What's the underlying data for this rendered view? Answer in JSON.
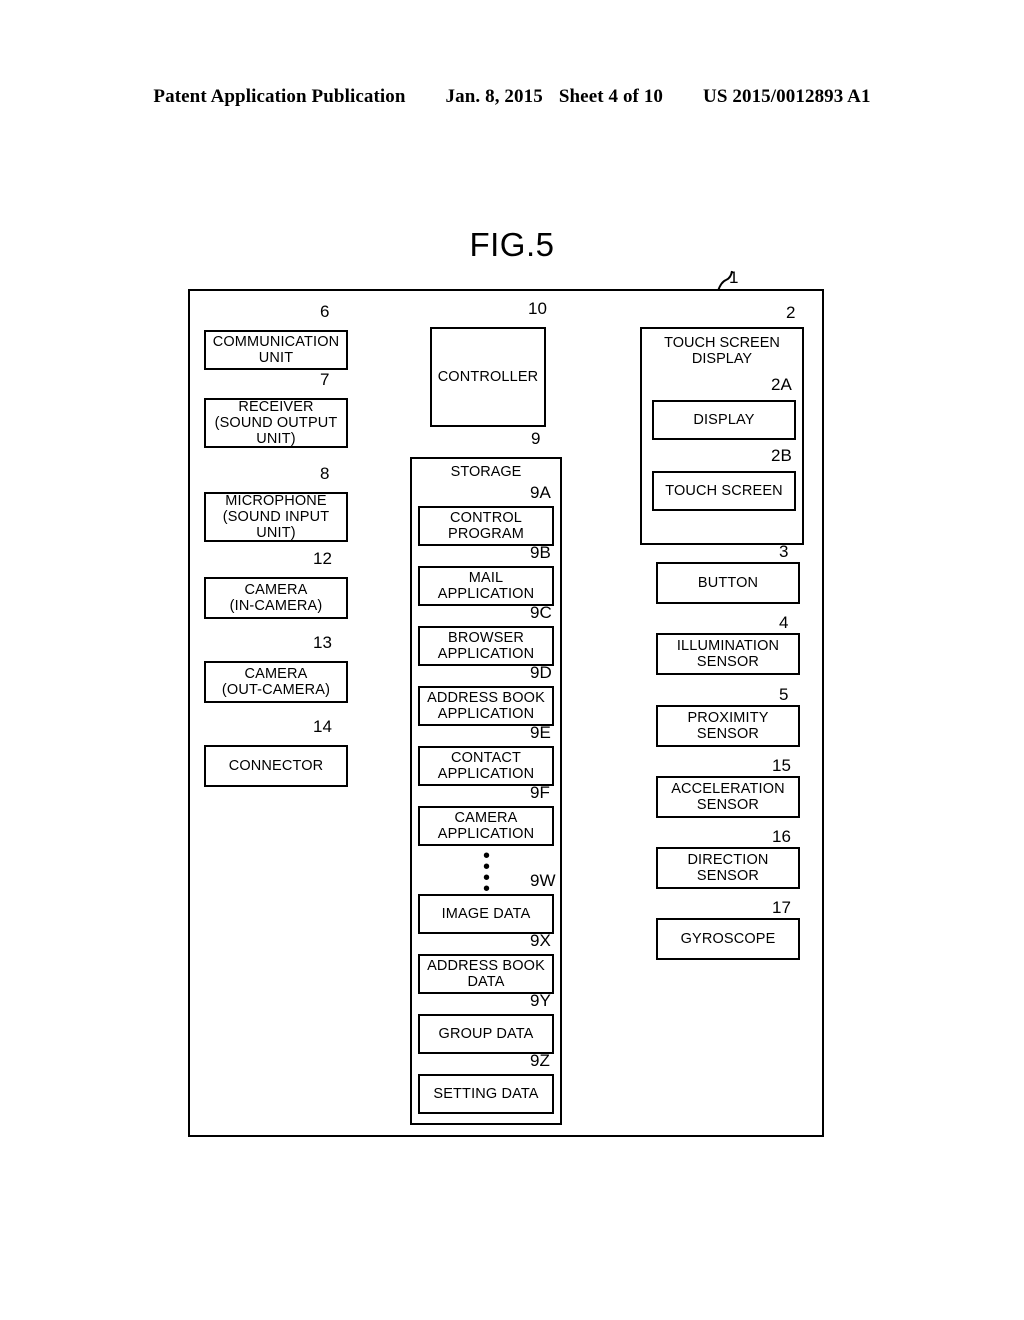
{
  "header": {
    "left": "Patent Application Publication",
    "date": "Jan. 8, 2015",
    "sheet": "Sheet 4 of 10",
    "pubnum": "US 2015/0012893 A1"
  },
  "figure": {
    "title": "FIG.5",
    "device_ref": "1"
  },
  "blocks": {
    "communication_unit": {
      "label": "COMMUNICATION\nUNIT",
      "ref": "6"
    },
    "receiver": {
      "label": "RECEIVER\n(SOUND OUTPUT\nUNIT)",
      "ref": "7"
    },
    "microphone": {
      "label": "MICROPHONE\n(SOUND INPUT\nUNIT)",
      "ref": "8"
    },
    "camera_in": {
      "label": "CAMERA\n(IN-CAMERA)",
      "ref": "12"
    },
    "camera_out": {
      "label": "CAMERA\n(OUT-CAMERA)",
      "ref": "13"
    },
    "connector": {
      "label": "CONNECTOR",
      "ref": "14"
    },
    "controller": {
      "label": "CONTROLLER",
      "ref": "10"
    },
    "storage": {
      "label": "STORAGE",
      "ref": "9"
    },
    "touch_screen_display": {
      "label": "TOUCH SCREEN\nDISPLAY",
      "ref": "2"
    },
    "display": {
      "label": "DISPLAY",
      "ref": "2A"
    },
    "touch_screen": {
      "label": "TOUCH SCREEN",
      "ref": "2B"
    },
    "button": {
      "label": "BUTTON",
      "ref": "3"
    },
    "illumination_sensor": {
      "label": "ILLUMINATION\nSENSOR",
      "ref": "4"
    },
    "proximity_sensor": {
      "label": "PROXIMITY\nSENSOR",
      "ref": "5"
    },
    "acceleration_sensor": {
      "label": "ACCELERATION\nSENSOR",
      "ref": "15"
    },
    "direction_sensor": {
      "label": "DIRECTION\nSENSOR",
      "ref": "16"
    },
    "gyroscope": {
      "label": "GYROSCOPE",
      "ref": "17"
    }
  },
  "storage_items": [
    {
      "label": "CONTROL\nPROGRAM",
      "ref": "9A"
    },
    {
      "label": "MAIL\nAPPLICATION",
      "ref": "9B"
    },
    {
      "label": "BROWSER\nAPPLICATION",
      "ref": "9C"
    },
    {
      "label": "ADDRESS BOOK\nAPPLICATION",
      "ref": "9D"
    },
    {
      "label": "CONTACT\nAPPLICATION",
      "ref": "9E"
    },
    {
      "label": "CAMERA\nAPPLICATION",
      "ref": "9F"
    },
    {
      "label": "IMAGE DATA",
      "ref": "9W"
    },
    {
      "label": "ADDRESS BOOK\nDATA",
      "ref": "9X"
    },
    {
      "label": "GROUP DATA",
      "ref": "9Y"
    },
    {
      "label": "SETTING DATA",
      "ref": "9Z"
    }
  ],
  "ellipsis": "••••",
  "colors": {
    "ink": "#000000",
    "paper": "#ffffff"
  }
}
